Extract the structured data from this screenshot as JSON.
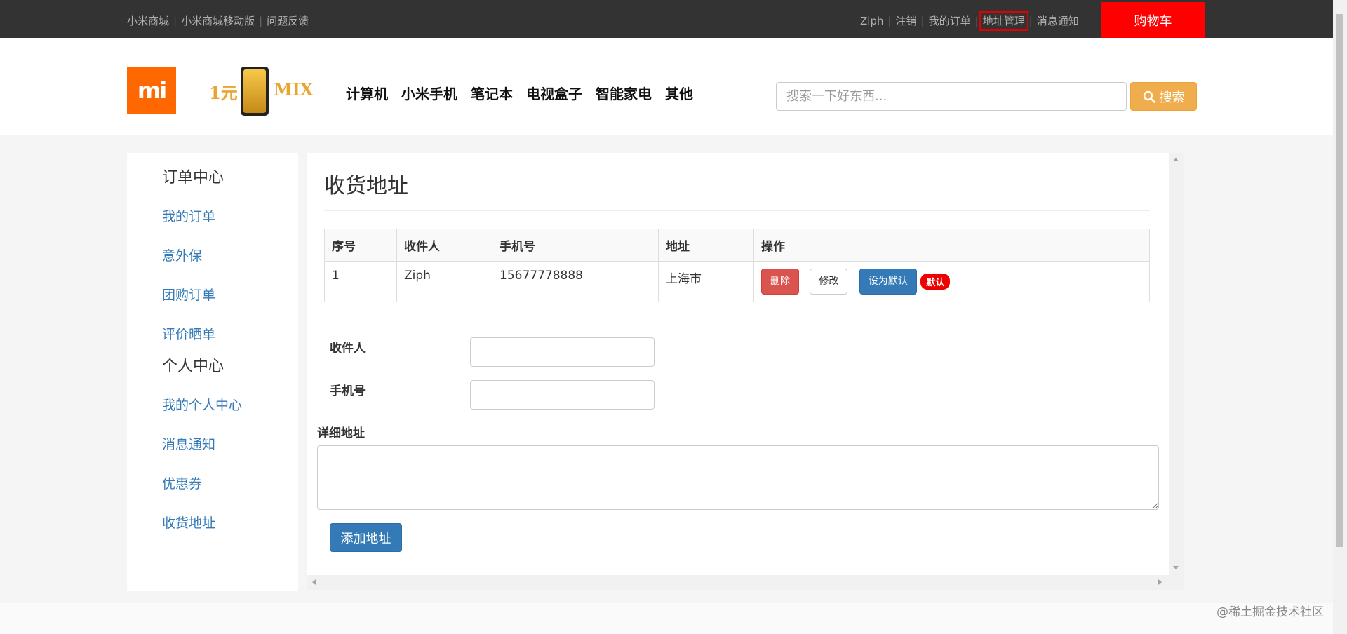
{
  "topbar": {
    "links_left": [
      "小米商城",
      "小米商城移动版",
      "问题反馈"
    ],
    "user": "Ziph",
    "logout": "注销",
    "my_orders": "我的订单",
    "address_mgmt": "地址管理",
    "messages": "消息通知",
    "cart": "购物车"
  },
  "header": {
    "logo_text": "mi",
    "promo_left": "1元",
    "promo_right": "MIX",
    "nav": [
      "计算机",
      "小米手机",
      "笔记本",
      "电视盒子",
      "智能家电",
      "其他"
    ],
    "search_placeholder": "搜索一下好东西...",
    "search_button": "搜索"
  },
  "sidebar": {
    "order_center": "订单中心",
    "order_items": [
      "我的订单",
      "意外保",
      "团购订单",
      "评价晒单"
    ],
    "personal_center": "个人中心",
    "personal_items": [
      "我的个人中心",
      "消息通知",
      "优惠券",
      "收货地址"
    ]
  },
  "main": {
    "title": "收货地址",
    "table": {
      "headers": [
        "序号",
        "收件人",
        "手机号",
        "地址",
        "操作"
      ],
      "rows": [
        {
          "index": "1",
          "name": "Ziph",
          "phone": "15677778888",
          "address": "上海市"
        }
      ],
      "delete": "删除",
      "edit": "修改",
      "set_default": "设为默认",
      "default_badge": "默认"
    },
    "form": {
      "recipient_label": "收件人",
      "phone_label": "手机号",
      "detail_label": "详细地址",
      "recipient_value": "",
      "phone_value": "",
      "detail_value": "",
      "submit": "添加地址"
    }
  },
  "watermark": "@稀土掘金技术社区",
  "colors": {
    "accent": "#ff6700",
    "cart": "#ff0000",
    "link": "#337ab7",
    "danger": "#d9534f",
    "warning": "#f0ad4e"
  }
}
